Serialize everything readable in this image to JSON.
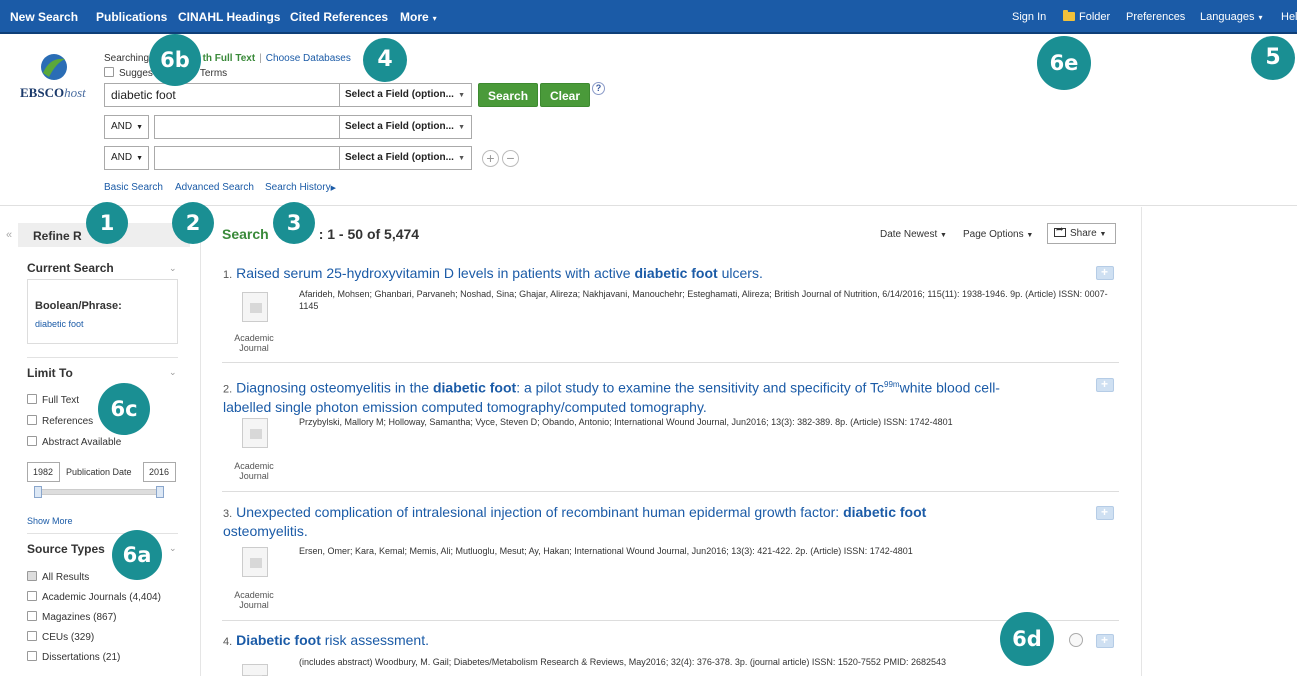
{
  "topnav": {
    "left": [
      "New Search",
      "Publications",
      "CINAHL Headings",
      "Cited References",
      "More"
    ],
    "right": {
      "sign_in": "Sign In",
      "folder": "Folder",
      "preferences": "Preferences",
      "languages": "Languages",
      "help": "Hel"
    }
  },
  "logo": {
    "brand": "EBSCO",
    "host": "host"
  },
  "search": {
    "searching_prefix": "Searching",
    "db_suffix": "th Full Text",
    "choose": "Choose Databases",
    "suggest_prefix": "Sugges",
    "suggest_suffix": "Terms",
    "query": "diabetic foot",
    "field_placeholder": "Select a Field (option...",
    "bool1": "AND",
    "bool2": "AND",
    "search_button": "Search",
    "clear_button": "Clear",
    "help": "?",
    "plus": "+",
    "minus": "−",
    "links": {
      "basic": "Basic Search",
      "advanced": "Advanced Search",
      "history": "Search History"
    }
  },
  "sidebar": {
    "refine_title": "Refine R",
    "current_search": "Current Search",
    "boolean_phrase": "Boolean/Phrase:",
    "boolean_value": "diabetic foot",
    "limit_to": "Limit To",
    "full_text": "Full Text",
    "references": "References",
    "abstract": "Abstract Available",
    "year_from": "1982",
    "pub_date": "Publication Date",
    "year_to": "2016",
    "show_more": "Show More",
    "source_types": "Source Types",
    "sources": [
      {
        "label": "All Results",
        "checked": true
      },
      {
        "label": "Academic Journals (4,404)",
        "checked": false
      },
      {
        "label": "Magazines (867)",
        "checked": false
      },
      {
        "label": "CEUs (329)",
        "checked": false
      },
      {
        "label": "Dissertations (21)",
        "checked": false
      }
    ]
  },
  "results": {
    "title_green": "Search",
    "title_count": ": 1 - 50 of 5,474",
    "sort": "Date Newest",
    "page_options": "Page Options",
    "share": "Share",
    "items": [
      {
        "num": "1.",
        "title_html_pre": "Raised serum 25-hydroxyvitamin D levels in patients with active ",
        "bold": "diabetic foot",
        "title_post": " ulcers.",
        "meta": "Afarideh, Mohsen; Ghanbari, Parvaneh; Noshad, Sina; Ghajar, Alireza; Nakhjavani, Manouchehr; Esteghamati, Alireza; British Journal of Nutrition, 6/14/2016; 115(11): 1938-1946. 9p. (Article) ISSN: 0007-1145",
        "type1": "Academic",
        "type2": "Journal"
      },
      {
        "num": "2.",
        "title_html_pre": "Diagnosing osteomyelitis in the ",
        "bold": "diabetic foot",
        "title_post": ": a pilot study to examine the sensitivity and specificity of Tc",
        "sup": "99m",
        "title_post2": "white blood cell-labelled single photon emission computed tomography/computed tomography.",
        "meta": "Przybylski, Mallory M; Holloway, Samantha; Vyce, Steven D; Obando, Antonio; International Wound Journal, Jun2016; 13(3): 382-389. 8p. (Article) ISSN: 1742-4801",
        "type1": "Academic",
        "type2": "Journal"
      },
      {
        "num": "3.",
        "title_html_pre": "Unexpected complication of intralesional injection of recombinant human epidermal growth factor: ",
        "bold": "diabetic foot",
        "title_post": " osteomyelitis.",
        "meta": "Ersen, Omer; Kara, Kemal; Memis, Ali; Mutluoglu, Mesut; Ay, Hakan; International Wound Journal, Jun2016; 13(3): 421-422. 2p. (Article) ISSN: 1742-4801",
        "type1": "Academic",
        "type2": "Journal"
      },
      {
        "num": "4.",
        "title_html_pre": "",
        "bold": "Diabetic foot",
        "title_post": " risk assessment.",
        "meta": "(includes abstract) Woodbury, M. Gail; Diabetes/Metabolism Research & Reviews, May2016; 32(4): 376-378. 3p. (journal article) ISSN: 1520-7552 PMID: 2682543"
      }
    ]
  },
  "callouts": [
    "1",
    "2",
    "3",
    "4",
    "5",
    "6a",
    "6b",
    "6c",
    "6d",
    "6e"
  ],
  "colors": {
    "nav": "#1b5ba7",
    "green": "#4a9a3a",
    "badge": "#1a8f93"
  }
}
